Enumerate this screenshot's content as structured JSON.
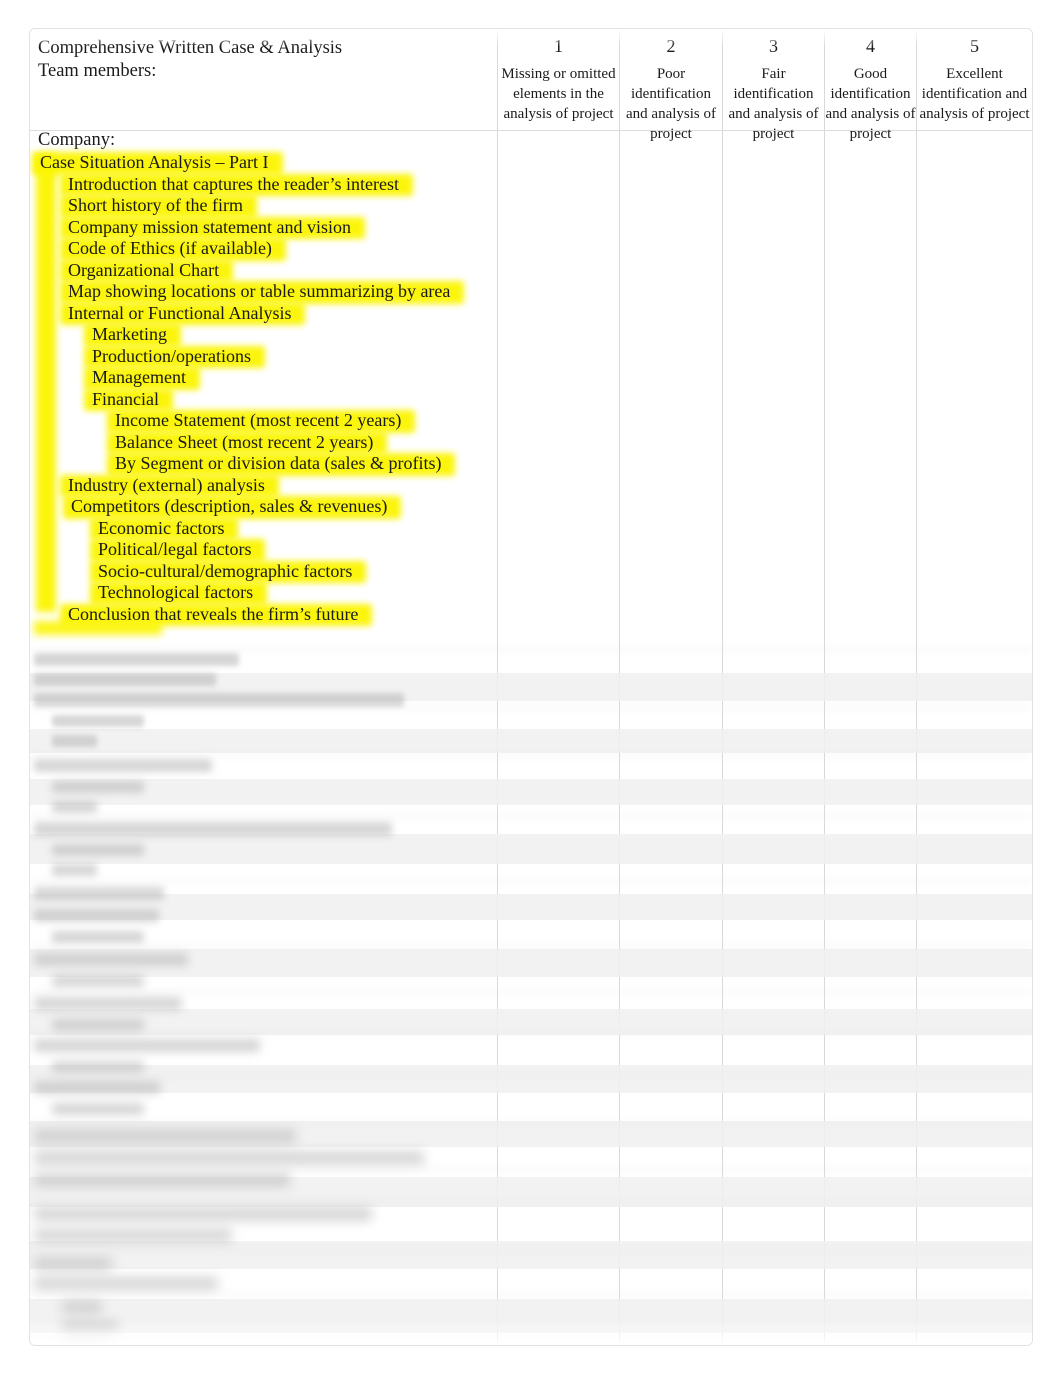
{
  "document": {
    "title": "Comprehensive Written Case & Analysis",
    "team_members_label": "Team members:",
    "company_label": "Company:"
  },
  "scale_columns": [
    {
      "number": "1",
      "descriptor": "Missing or omitted elements in the analysis of project"
    },
    {
      "number": "2",
      "descriptor": "Poor identification and analysis of project"
    },
    {
      "number": "3",
      "descriptor": "Fair identification and analysis of project"
    },
    {
      "number": "4",
      "descriptor": "Good identification and analysis of project"
    },
    {
      "number": "5",
      "descriptor": "Excellent identification and analysis of project"
    }
  ],
  "criteria": [
    {
      "text": "Case Situation Analysis – Part I",
      "level": 0,
      "highlight": true
    },
    {
      "text": "Introduction that captures the reader’s interest",
      "level": 1,
      "highlight": true
    },
    {
      "text": "Short history of the firm",
      "level": 1,
      "highlight": true
    },
    {
      "text": "Company mission statement and vision",
      "level": 1,
      "highlight": true
    },
    {
      "text": "Code of Ethics (if available)",
      "level": 1,
      "highlight": true
    },
    {
      "text": "Organizational Chart",
      "level": 1,
      "highlight": true
    },
    {
      "text": "Map showing locations or table summarizing by area",
      "level": 1,
      "highlight": true
    },
    {
      "text": "Internal or Functional Analysis",
      "level": 1,
      "highlight": true
    },
    {
      "text": "Marketing",
      "level": 2,
      "highlight": true
    },
    {
      "text": "Production/operations",
      "level": 2,
      "highlight": true
    },
    {
      "text": "Management",
      "level": 2,
      "highlight": true
    },
    {
      "text": "Financial",
      "level": 2,
      "highlight": true
    },
    {
      "text": "Income Statement (most recent 2 years)",
      "level": 3,
      "highlight": true
    },
    {
      "text": "Balance Sheet (most recent 2 years)",
      "level": 3,
      "highlight": true
    },
    {
      "text": "By Segment or division data (sales & profits)",
      "level": 3,
      "highlight": true
    },
    {
      "text": "Industry (external) analysis",
      "level": 1,
      "highlight": true
    },
    {
      "text": "Competitors (description, sales & revenues)",
      "level": 2,
      "highlight": true
    },
    {
      "text": "Economic factors",
      "level": 2,
      "highlight": true
    },
    {
      "text": "Political/legal factors",
      "level": 2,
      "highlight": true
    },
    {
      "text": "Socio-cultural/demographic factors",
      "level": 2,
      "highlight": true
    },
    {
      "text": "Technological factors",
      "level": 2,
      "highlight": true
    },
    {
      "text": "Conclusion that reveals the firm’s future",
      "level": 1,
      "highlight": true
    }
  ],
  "lower_section": {
    "state": "out-of-focus",
    "note": "Remaining rubric rows are rendered out of focus and are not legible in the screenshot."
  },
  "colors": {
    "highlight": "#fbf500",
    "grid_line": "#d9d9d9",
    "row_line": "#e6e6e6",
    "text": "#1a1a1a",
    "page_background": "#ffffff",
    "cell_shade": "#f0f0f0"
  }
}
